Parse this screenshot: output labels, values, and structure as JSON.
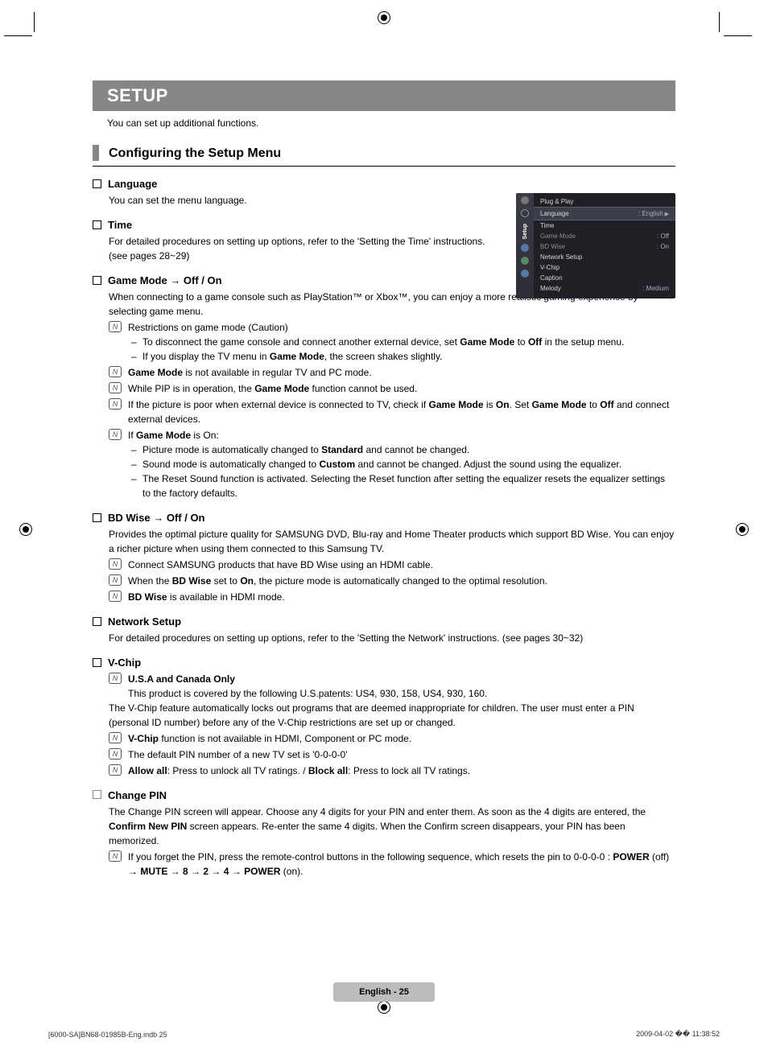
{
  "banner": "SETUP",
  "intro": "You can set up additional functions.",
  "sectionTitle": "Configuring the Setup Menu",
  "language": {
    "title": "Language",
    "desc": "You can set the menu language."
  },
  "time": {
    "title": "Time",
    "desc1": "For detailed procedures on setting up options, refer to the 'Setting the Time' instructions.",
    "desc2": "(see pages 28~29)"
  },
  "gameMode": {
    "title": "Game Mode → Off / On",
    "desc": "When connecting to a game console such as PlayStation™ or Xbox™, you can enjoy a more realistic gaming experience by selecting game menu.",
    "note1_lead": "Restrictions on game mode (Caution)",
    "dash1a_p1": "To disconnect the game console and connect another external device, set ",
    "dash1a_b1": "Game Mode",
    "dash1a_p2": " to ",
    "dash1a_b2": "Off",
    "dash1a_p3": " in the setup menu.",
    "dash1b_p1": "If you display the TV menu in ",
    "dash1b_b1": "Game Mode",
    "dash1b_p2": ", the screen shakes slightly.",
    "note2_b": "Game Mode",
    "note2_p": " is not available in regular TV and PC mode.",
    "note3_p1": "While PIP is in operation, the ",
    "note3_b": "Game Mode",
    "note3_p2": " function cannot be used.",
    "note4_p1": "If the picture is poor when external device is connected to TV, check if ",
    "note4_b1": "Game Mode",
    "note4_p2": " is ",
    "note4_b2": "On",
    "note4_p3": ". Set ",
    "note4_b3": "Game Mode",
    "note4_p4": " to ",
    "note4_b4": "Off",
    "note4_p5": " and connect external devices.",
    "note5_p1": "If ",
    "note5_b": "Game Mode",
    "note5_p2": " is On:",
    "dash5a_p1": "Picture mode is automatically changed to ",
    "dash5a_b": "Standard",
    "dash5a_p2": " and cannot be changed.",
    "dash5b_p1": "Sound mode is automatically changed to ",
    "dash5b_b": "Custom",
    "dash5b_p2": " and cannot be changed. Adjust the sound using the equalizer.",
    "dash5c": "The Reset Sound function is activated. Selecting the Reset function after setting the equalizer resets the equalizer settings to the factory defaults."
  },
  "bdWise": {
    "title": "BD Wise → Off / On",
    "desc": "Provides the optimal picture quality for SAMSUNG DVD, Blu-ray and Home Theater products which support BD Wise. You can enjoy a richer picture when using them connected to this Samsung TV.",
    "note1": "Connect SAMSUNG products that have BD Wise using an HDMI cable.",
    "note2_p1": "When the ",
    "note2_b1": "BD Wise",
    "note2_p2": " set to ",
    "note2_b2": "On",
    "note2_p3": ", the picture mode is automatically changed to the optimal resolution.",
    "note3_b": "BD Wise",
    "note3_p": " is available in HDMI mode."
  },
  "network": {
    "title": "Network Setup",
    "desc": "For detailed procedures on setting up options, refer to the 'Setting the Network' instructions. (see pages 30~32)"
  },
  "vchip": {
    "title": "V-Chip",
    "note1_b": "U.S.A and Canada Only",
    "note1_sub": "This product is covered by the following U.S.patents: US4, 930, 158, US4, 930, 160.",
    "desc": "The V-Chip feature automatically locks out programs that are deemed inappropriate for children. The user must enter a PIN (personal ID number) before any of the V-Chip restrictions are set up or changed.",
    "note2_b": "V-Chip",
    "note2_p": " function is not available in HDMI, Component or PC mode.",
    "note3": "The default PIN number of a new TV set is '0-0-0-0'",
    "note4_b1": "Allow all",
    "note4_p1": ": Press to unlock all TV ratings. / ",
    "note4_b2": "Block all",
    "note4_p2": ": Press to lock all TV ratings."
  },
  "changePin": {
    "title": "Change PIN",
    "desc_p1": "The Change PIN screen will appear. Choose any 4 digits for your PIN and enter them. As soon as the 4 digits are entered, the ",
    "desc_b1": "Confirm New PIN",
    "desc_p2": " screen appears. Re-enter the same 4 digits. When the Confirm screen disappears, your PIN has been memorized.",
    "note_p1": "If you forget the PIN, press the remote-control buttons in the following sequence, which resets the pin to 0-0-0-0 : ",
    "note_b1": "POWER",
    "note_p2": " (off) → ",
    "note_b2": "MUTE",
    "note_p3": " → ",
    "note_b3": "8",
    "note_p4": " → ",
    "note_b4": "2",
    "note_p5": " → ",
    "note_b5": "4",
    "note_p6": " → ",
    "note_b6": "POWER",
    "note_p7": " (on)."
  },
  "osd": {
    "sidebar": "Setup",
    "rows": [
      {
        "label": "Plug & Play",
        "val": ""
      },
      {
        "label": "Language",
        "val": ": English",
        "sel": true
      },
      {
        "label": "Time",
        "val": ""
      },
      {
        "label": "Game Mode",
        "val": ": Off",
        "dim": true
      },
      {
        "label": "BD Wise",
        "val": ": On",
        "dim": true
      },
      {
        "label": "Network Setup",
        "val": ""
      },
      {
        "label": "V-Chip",
        "val": ""
      },
      {
        "label": "Caption",
        "val": ""
      },
      {
        "label": "Melody",
        "val": ": Medium"
      }
    ]
  },
  "footer": "English - 25",
  "metaLeft": "[6000-SA]BN68-01985B-Eng.indb   25",
  "metaRight": "2009-04-02   �� 11:38:52"
}
